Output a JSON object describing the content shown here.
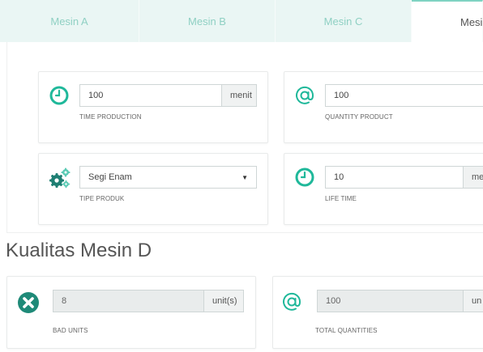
{
  "tabs": [
    {
      "label": "Mesin A"
    },
    {
      "label": "Mesin B"
    },
    {
      "label": "Mesin C"
    },
    {
      "label": "Mesin"
    }
  ],
  "machine_cards": {
    "time_production": {
      "value": "100",
      "unit": "menit",
      "caption": "TIME PRODUCTION",
      "icon": "clock-icon"
    },
    "quantity_product": {
      "value": "100",
      "caption": "QUANTITY PRODUCT",
      "icon": "at-icon"
    },
    "tipe_produk": {
      "selected": "Segi Enam",
      "caption": "TIPE PRODUK",
      "icon": "gears-icon"
    },
    "life_time": {
      "value": "10",
      "unit": "me",
      "caption": "LIFE TIME",
      "icon": "clock-icon"
    }
  },
  "quality": {
    "title": "Kualitas Mesin D",
    "bad_units": {
      "value": "8",
      "unit": "unit(s)",
      "caption": "BAD UNITS",
      "icon": "x-circle-icon"
    },
    "total_quantities": {
      "value": "100",
      "unit": "un",
      "caption": "TOTAL QUANTITIES",
      "icon": "at-icon"
    }
  },
  "colors": {
    "accent": "#1fb89a",
    "tab_bg": "#eaf6f4",
    "tab_text": "#8fd0c3",
    "bad": "#1f8a78"
  }
}
